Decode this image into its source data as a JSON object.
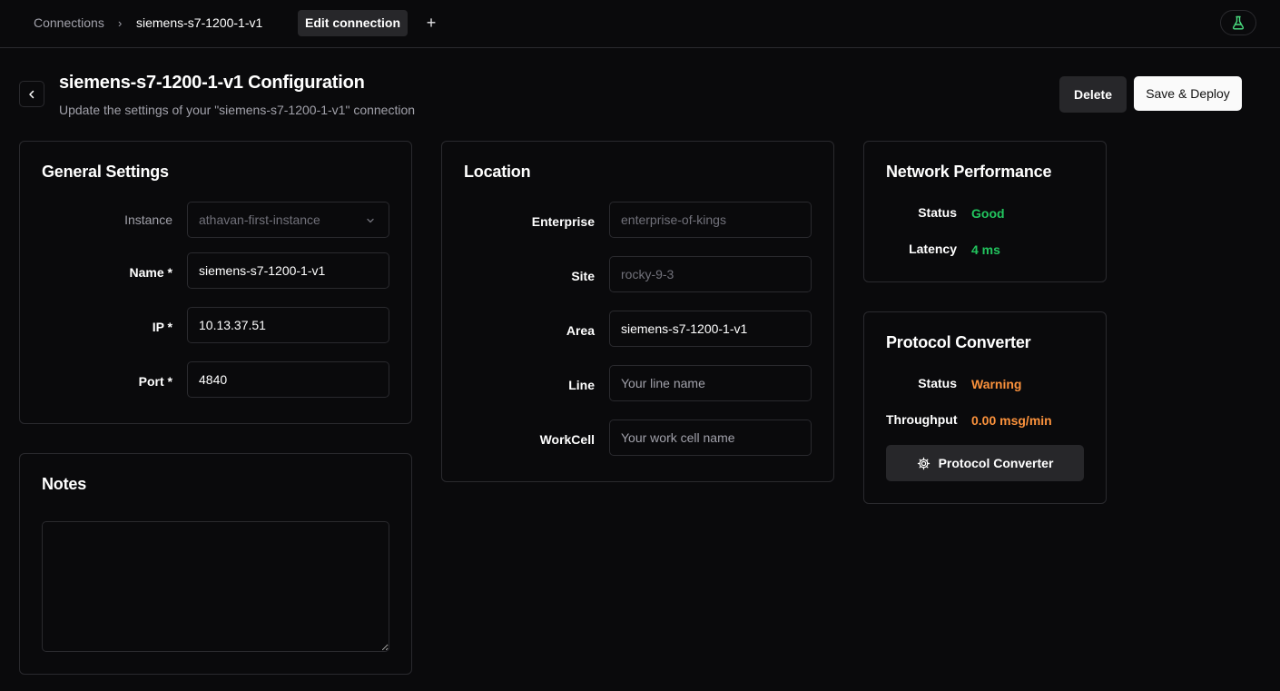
{
  "breadcrumb": {
    "root": "Connections",
    "separator": "›",
    "current": "siemens-s7-1200-1-v1",
    "active_tab": "Edit connection",
    "add_tab": "+"
  },
  "header": {
    "title": "siemens-s7-1200-1-v1 Configuration",
    "subtitle": "Update the settings of your \"siemens-s7-1200-1-v1\" connection",
    "delete_label": "Delete",
    "save_label": "Save & Deploy"
  },
  "general": {
    "title": "General Settings",
    "instance_label": "Instance",
    "instance_value": "athavan-first-instance",
    "name_label": "Name *",
    "name_value": "siemens-s7-1200-1-v1",
    "ip_label": "IP *",
    "ip_value": "10.13.37.51",
    "port_label": "Port *",
    "port_value": "4840"
  },
  "notes": {
    "title": "Notes",
    "value": ""
  },
  "location": {
    "title": "Location",
    "enterprise_label": "Enterprise",
    "enterprise_value": "enterprise-of-kings",
    "site_label": "Site",
    "site_value": "rocky-9-3",
    "area_label": "Area",
    "area_value": "siemens-s7-1200-1-v1",
    "line_label": "Line",
    "line_placeholder": "Your line name",
    "workcell_label": "WorkCell",
    "workcell_placeholder": "Your work cell name"
  },
  "network": {
    "title": "Network Performance",
    "status_label": "Status",
    "status_value": "Good",
    "latency_label": "Latency",
    "latency_value": "4 ms"
  },
  "converter": {
    "title": "Protocol Converter",
    "status_label": "Status",
    "status_value": "Warning",
    "throughput_label": "Throughput",
    "throughput_value": "0.00 msg/min",
    "button_label": "Protocol Converter"
  },
  "colors": {
    "good": "#22c55e",
    "warning": "#fb923c",
    "flask": "#4ade80"
  },
  "icons": [
    "chevron-left-icon",
    "chevron-down-icon",
    "flask-icon",
    "gear-icon",
    "plus-icon"
  ]
}
